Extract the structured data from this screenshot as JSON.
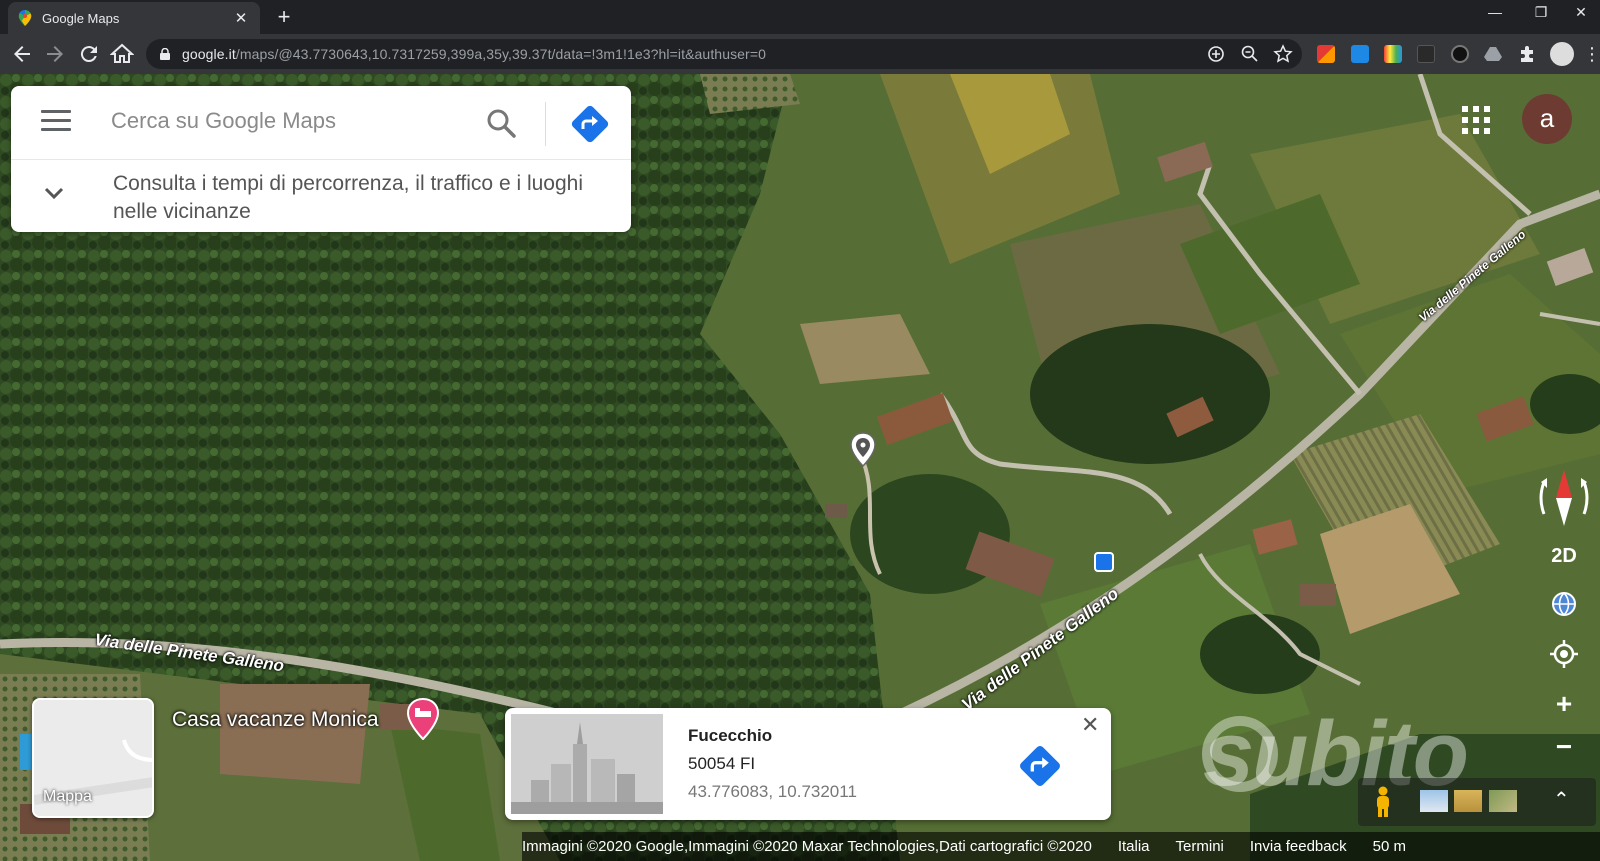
{
  "browser": {
    "tab_title": "Google Maps",
    "tab_close": "✕",
    "new_tab": "+",
    "url_domain": "google.it",
    "url_path": "/maps/@43.7730643,10.7317259,399a,35y,39.37t/data=!3m1!1e3?hl=it&authuser=0",
    "window_controls": [
      "—",
      "❐",
      "✕"
    ]
  },
  "search": {
    "placeholder": "Cerca su Google Maps",
    "hint": "Consulta i tempi di percorrenza, il traffico e i luoghi nelle vicinanze"
  },
  "account": {
    "initial": "a",
    "color": "#6d3b31"
  },
  "map": {
    "road_labels": [
      "Via delle Pinete Galleno",
      "Via delle Pinete Galleno",
      "Via delle Pinete Galleno"
    ],
    "poi_label": "Casa vacanze Monica",
    "map_type_label": "Mappa"
  },
  "info_card": {
    "title": "Fucecchio",
    "postal": "50054 FI",
    "coords": "43.776083, 10.732011",
    "close": "✕"
  },
  "controls": {
    "mode_label": "2D",
    "zoom_in": "+",
    "zoom_out": "−",
    "expand": "⌃"
  },
  "watermark": "subito",
  "footer": {
    "imagery": "Immagini ©2020 Google,Immagini ©2020 Maxar Technologies,Dati cartografici ©2020",
    "country": "Italia",
    "terms": "Termini",
    "feedback": "Invia feedback",
    "scale": "50 m"
  },
  "colors": {
    "accent_blue": "#4285f4",
    "poi_pink": "#e91e63"
  }
}
